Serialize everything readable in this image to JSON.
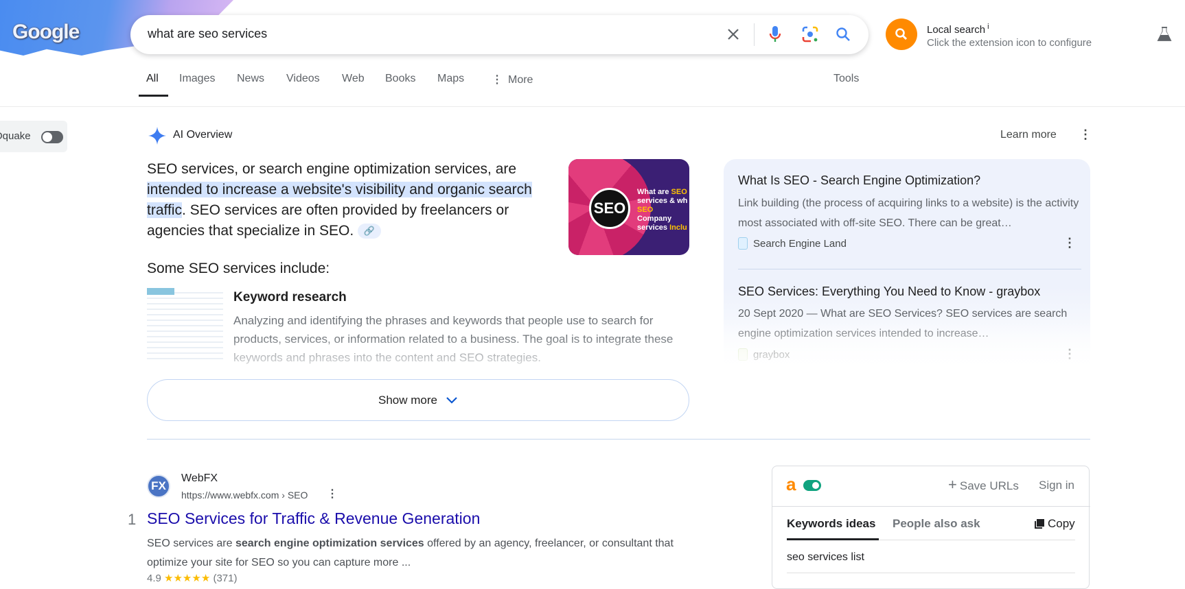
{
  "header": {
    "logo_text": "Google",
    "search_query": "what are seo services",
    "local_search": {
      "title": "Local search",
      "info": "i",
      "subtitle": "Click the extension icon to configure"
    }
  },
  "tabs": [
    {
      "label": "All",
      "active": true
    },
    {
      "label": "Images"
    },
    {
      "label": "News"
    },
    {
      "label": "Videos"
    },
    {
      "label": "Web"
    },
    {
      "label": "Books"
    },
    {
      "label": "Maps"
    },
    {
      "label": "More"
    }
  ],
  "tools_label": "Tools",
  "oquake": {
    "label": "Oquake",
    "enabled": false
  },
  "ai_overview": {
    "title": "AI Overview",
    "learn_more": "Learn more",
    "para_1": "SEO services, or search engine optimization services, are ",
    "para_highlight": "intended to increase a website's visibility and organic search traffic",
    "para_2": ". SEO services are often provided by freelancers or agencies that specialize in SEO.",
    "image": {
      "center": "SEO",
      "caption_1": "What are ",
      "caption_1b": "SEO",
      "caption_2": "services & wh",
      "caption_3": "SEO",
      "caption_3b": " Company",
      "caption_4": "services ",
      "caption_4b": "Inclu"
    },
    "include_heading": "Some SEO services include:",
    "items": [
      {
        "title": "Keyword research",
        "description": "Analyzing and identifying the phrases and keywords that people use to search for products, services, or information related to a business. The goal is to integrate these keywords and phrases into the content and SEO strategies."
      }
    ],
    "show_more": "Show more",
    "sources": [
      {
        "title": "What Is SEO - Search Engine Optimization?",
        "snippet": "Link building (the process of acquiring links to a website) is the activity most associated with off-site SEO. There can be great…",
        "site": "Search Engine Land"
      },
      {
        "title": "SEO Services: Everything You Need to Know - graybox",
        "snippet": "20 Sept 2020 — What are SEO Services? SEO services are search engine optimization services intended to increase…",
        "site": "graybox"
      }
    ]
  },
  "results": [
    {
      "rank": "1",
      "favicon_text": "FX",
      "site": "WebFX",
      "url": "https://www.webfx.com › SEO",
      "title": "SEO Services for Traffic & Revenue Generation",
      "snippet_1": "SEO services are ",
      "snippet_bold": "search engine optimization services",
      "snippet_2": " offered by an agency, freelancer, or consultant that optimize your site for SEO so you can capture more ...",
      "rating": "4.9",
      "stars": "★★★★★",
      "reviews": "(371)"
    }
  ],
  "extension_panel": {
    "logo": "a",
    "enabled": true,
    "save_urls": "Save URLs",
    "sign_in": "Sign in",
    "tabs": [
      "Keywords ideas",
      "People also ask"
    ],
    "copy": "Copy",
    "keywords": [
      "seo services list"
    ]
  },
  "colors": {
    "link": "#1a0dab",
    "highlight": "#d3e3fd",
    "extension_orange": "#ff8a00",
    "toggle_green": "#10a37f"
  }
}
